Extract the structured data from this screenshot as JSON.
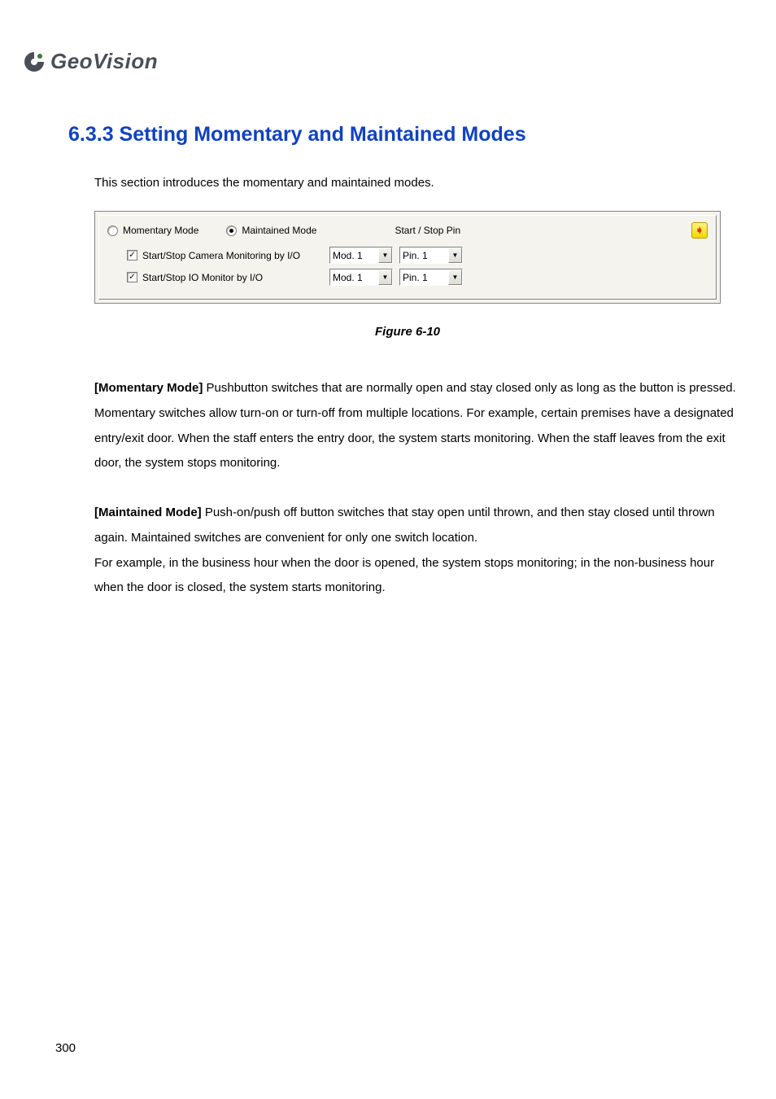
{
  "logo": {
    "text": "GeoVision"
  },
  "heading": "6.3.3   Setting Momentary and Maintained Modes",
  "intro": "This section introduces the momentary and maintained modes.",
  "dialog": {
    "radio_momentary": "Momentary Mode",
    "radio_maintained": "Maintained Mode",
    "startstop_pin": "Start / Stop Pin",
    "checkbox1_label": "Start/Stop Camera Monitoring by I/O",
    "checkbox2_label": "Start/Stop IO Monitor by I/O",
    "mod_row1": "Mod. 1",
    "pin_row1": "Pin. 1",
    "mod_row2": "Mod. 1",
    "pin_row2": "Pin. 1"
  },
  "figure_caption": "Figure 6-10",
  "para1_bold": "[Momentary Mode]",
  "para1_text": " Pushbutton switches that are normally open and stay closed only as long as the button is pressed. Momentary switches allow turn-on or turn-off from multiple locations. For example, certain premises have a designated entry/exit door. When the staff enters the entry door, the system starts monitoring. When the staff leaves from the exit door, the system stops monitoring.",
  "para2_bold": "[Maintained Mode]",
  "para2_text": " Push-on/push off button switches that stay open until thrown, and then stay closed until thrown again. Maintained switches are convenient for only one switch location.",
  "para2_line2": "For example, in the business hour when the door is opened, the system stops monitoring; in the non-business hour when the door is closed, the system starts monitoring.",
  "page_number": "300"
}
